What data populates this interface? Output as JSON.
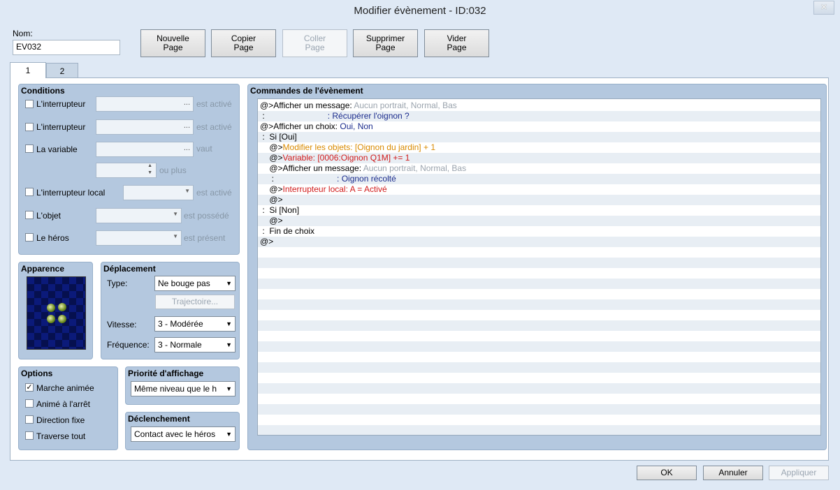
{
  "window": {
    "title": "Modifier évènement - ID:032",
    "close": "×"
  },
  "name": {
    "label": "Nom:",
    "value": "EV032"
  },
  "toolbar": {
    "new_page": "Nouvelle\nPage",
    "copy_page": "Copier\nPage",
    "paste_page": "Coller\nPage",
    "delete_page": "Supprimer\nPage",
    "clear_page": "Vider\nPage"
  },
  "tabs": [
    {
      "label": "1"
    },
    {
      "label": "2"
    }
  ],
  "conditions": {
    "title": "Conditions",
    "switch1": {
      "label": "L'interrupteur",
      "suffix": "est activé",
      "dots": "..."
    },
    "switch2": {
      "label": "L'interrupteur",
      "suffix": "est activé",
      "dots": "..."
    },
    "variable": {
      "label": "La variable",
      "suffix": "vaut",
      "dots": "...",
      "more": "ou plus"
    },
    "self_switch": {
      "label": "L'interrupteur local",
      "suffix": "est activé"
    },
    "item": {
      "label": "L'objet",
      "suffix": "est possédé"
    },
    "hero": {
      "label": "Le héros",
      "suffix": "est présent"
    }
  },
  "appearance": {
    "title": "Apparence"
  },
  "movement": {
    "title": "Déplacement",
    "type_label": "Type:",
    "type_value": "Ne bouge pas",
    "route_button": "Trajectoire...",
    "speed_label": "Vitesse:",
    "speed_value": "3 - Modérée",
    "freq_label": "Fréquence:",
    "freq_value": "3 - Normale"
  },
  "options": {
    "title": "Options",
    "walking_anim": {
      "label": "Marche animée",
      "checked": "✓"
    },
    "stepping_anim": {
      "label": "Animé à l'arrêt"
    },
    "direction_fix": {
      "label": "Direction fixe"
    },
    "through": {
      "label": "Traverse tout"
    }
  },
  "priority": {
    "title": "Priorité d'affichage",
    "value": "Même niveau que le h"
  },
  "trigger": {
    "title": "Déclenchement",
    "value": "Contact avec le héros"
  },
  "commands": {
    "title": "Commandes de l'évènement",
    "rows": [
      {
        "a": "@>Afficher un message: ",
        "b": "Aucun portrait, Normal, Bas"
      },
      {
        "a": " :                           ",
        "b": ": Récupérer l'oignon ?"
      },
      {
        "a": "@>Afficher un choix: ",
        "b": "Oui, Non"
      },
      {
        "a": " :  Si [Oui]",
        "b": ""
      },
      {
        "a": "    @>",
        "b": "Modifier les objets: [Oignon du jardin] + 1"
      },
      {
        "a": "    @>",
        "b": "Variable: [0006:Oignon Q1M] += 1"
      },
      {
        "a": "    @>Afficher un message: ",
        "b": "Aucun portrait, Normal, Bas"
      },
      {
        "a": "     :                           ",
        "b": ": Oignon récolté"
      },
      {
        "a": "    @>",
        "b": "Interrupteur local: A = Activé"
      },
      {
        "a": "    @>",
        "b": ""
      },
      {
        "a": " :  Si [Non]",
        "b": ""
      },
      {
        "a": "    @>",
        "b": ""
      },
      {
        "a": " :  Fin de choix",
        "b": ""
      },
      {
        "a": "@>",
        "b": ""
      }
    ]
  },
  "footer": {
    "ok": "OK",
    "cancel": "Annuler",
    "apply": "Appliquer"
  },
  "icons": {
    "sprite": "onion-sprite-icon",
    "dropdown": "chevron-down-icon"
  }
}
